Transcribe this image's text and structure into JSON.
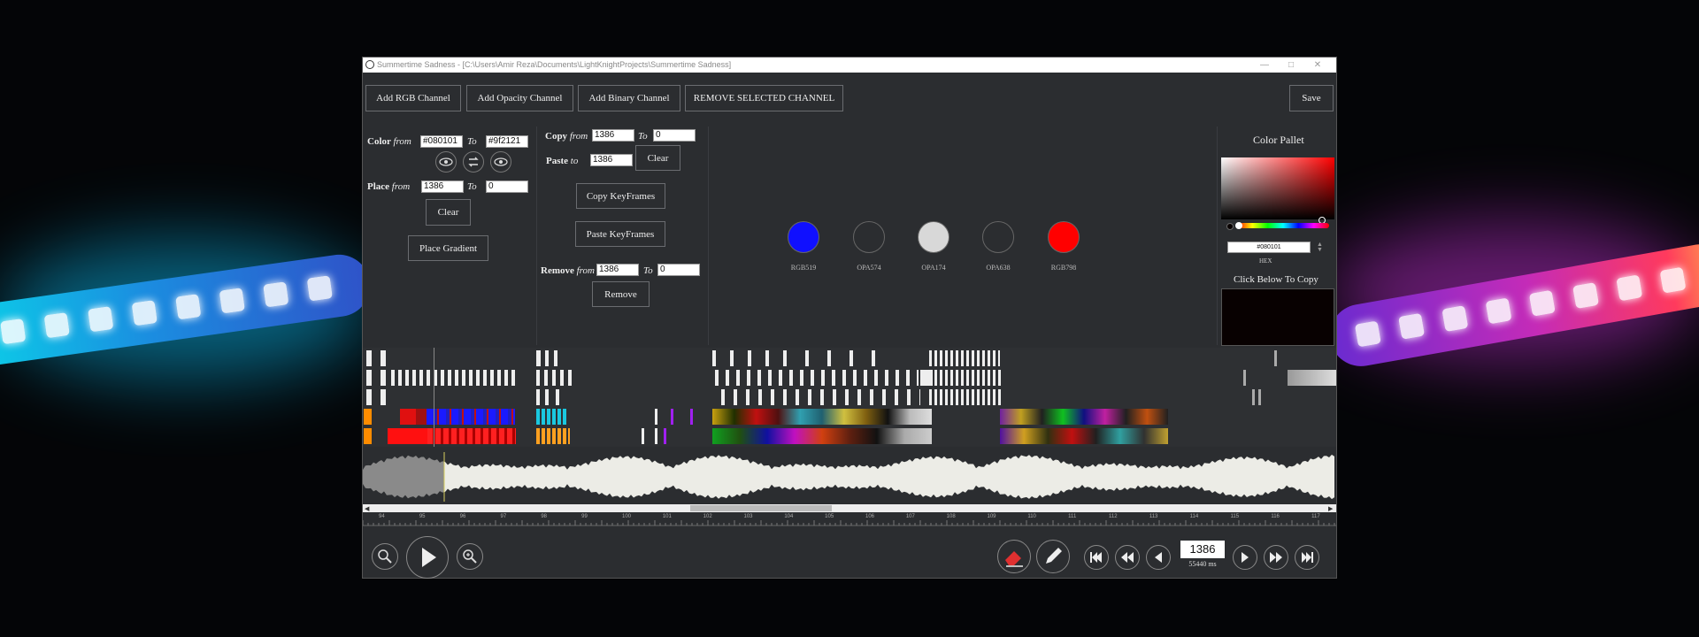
{
  "window": {
    "title": "Summertime Sadness - [C:\\Users\\Amir Reza\\Documents\\LightKnightProjects\\Summertime Sadness]"
  },
  "toolbar": {
    "add_rgb": "Add RGB Channel",
    "add_opacity": "Add Opacity Channel",
    "add_binary": "Add Binary Channel",
    "remove_selected": "REMOVE SELECTED CHANNEL",
    "save": "Save"
  },
  "color_panel": {
    "color_label": "Color",
    "from_label": "from",
    "to_label": "To",
    "color_from": "#080101",
    "color_to": "#9f2121",
    "place_label": "Place",
    "place_from": "1386",
    "place_to": "0",
    "clear": "Clear",
    "place_gradient": "Place Gradient"
  },
  "copy_panel": {
    "copy_label": "Copy",
    "from_label": "from",
    "to_label": "To",
    "copy_from": "1386",
    "copy_to": "0",
    "paste_label": "Paste",
    "paste_to_label": "to",
    "paste_to": "1386",
    "clear": "Clear",
    "copy_keyframes": "Copy KeyFrames",
    "paste_keyframes": "Paste KeyFrames",
    "remove_label": "Remove",
    "remove_from": "1386",
    "remove_to": "0",
    "remove": "Remove"
  },
  "channels": [
    {
      "name": "RGB519",
      "color": "#1010ff"
    },
    {
      "name": "OPA574",
      "color": "#2b2d30"
    },
    {
      "name": "OPA174",
      "color": "#d8d8d8"
    },
    {
      "name": "OPA638",
      "color": "#2b2d30"
    },
    {
      "name": "RGB798",
      "color": "#ff0000"
    }
  ],
  "palette": {
    "title": "Color Pallet",
    "hex_value": "#080101",
    "hex_label": "HEX",
    "copy_hint": "Click Below To Copy",
    "preview_color": "#080101"
  },
  "timeline": {
    "ruler_ticks": [
      "94",
      "95",
      "96",
      "97",
      "98",
      "99",
      "100",
      "101",
      "102",
      "103",
      "104",
      "105",
      "106",
      "107",
      "108",
      "109",
      "110",
      "111",
      "112",
      "113",
      "114",
      "115",
      "116",
      "117"
    ]
  },
  "transport": {
    "current_frame": "1386",
    "time_ms": "55440 ms"
  }
}
